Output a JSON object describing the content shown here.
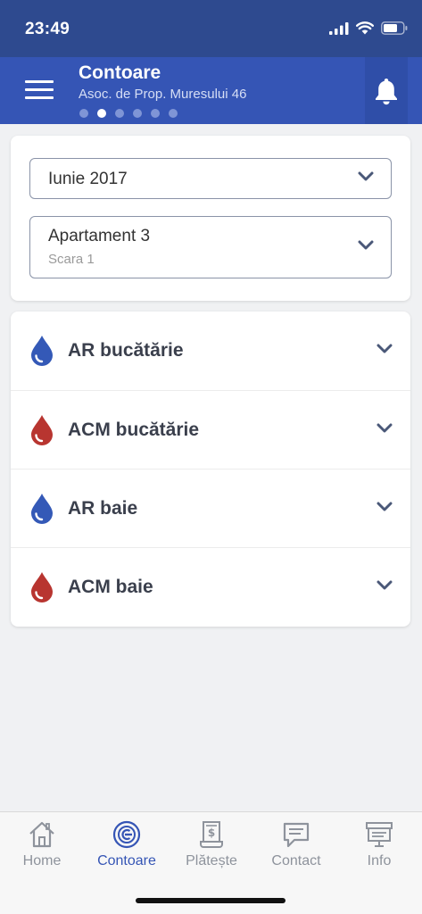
{
  "status_bar": {
    "time": "23:49"
  },
  "header": {
    "title": "Contoare",
    "subtitle": "Asoc. de Prop. Muresului 46",
    "page_dots": 6,
    "active_dot": 1
  },
  "filters": {
    "month": {
      "value": "Iunie 2017"
    },
    "apartment": {
      "value": "Apartament 3",
      "sub": "Scara 1"
    }
  },
  "meters": [
    {
      "label": "AR bucătărie",
      "type": "cold"
    },
    {
      "label": "ACM bucătărie",
      "type": "hot"
    },
    {
      "label": "AR baie",
      "type": "cold"
    },
    {
      "label": "ACM baie",
      "type": "hot"
    }
  ],
  "tabs": [
    {
      "label": "Home",
      "icon": "home-icon"
    },
    {
      "label": "Contoare",
      "icon": "meter-icon"
    },
    {
      "label": "Plătește",
      "icon": "bill-icon"
    },
    {
      "label": "Contact",
      "icon": "chat-icon"
    },
    {
      "label": "Info",
      "icon": "info-board-icon"
    }
  ],
  "active_tab": 1,
  "colors": {
    "header_bg": "#3555b5",
    "status_bg": "#2e4a8f",
    "cold_water": "#3459b7",
    "hot_water": "#b83530",
    "active_tab": "#3555b5",
    "inactive_tab": "#8e939c"
  }
}
